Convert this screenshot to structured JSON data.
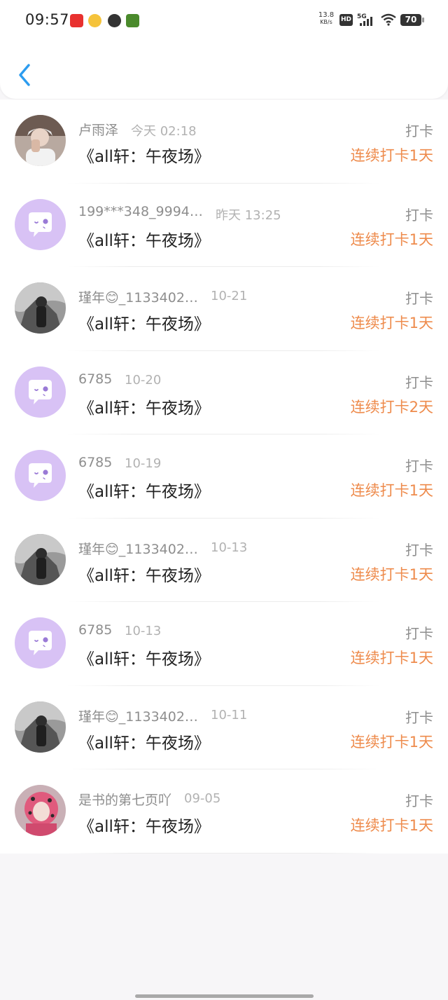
{
  "status_bar": {
    "time": "09:57",
    "net_speed_value": "13.8",
    "net_speed_unit": "KB/s",
    "hd_label": "HD",
    "network_label": "5G",
    "battery_level": "70"
  },
  "colors": {
    "accent_back": "#2c9cef",
    "streak": "#ee8b4c",
    "default_avatar_bg": "#d8c2f5"
  },
  "list": {
    "items": [
      {
        "name": "卢雨泽",
        "date": "今天 02:18",
        "book": "《all轩：午夜场》",
        "action": "打卡",
        "streak": "连续打卡1天",
        "avatar": "photo-user-avatar"
      },
      {
        "name": "199***348_9994…",
        "date": "昨天 13:25",
        "book": "《all轩：午夜场》",
        "action": "打卡",
        "streak": "连续打卡1天",
        "avatar": "default-chat-avatar"
      },
      {
        "name": "瑾年😊_1133402…",
        "date": "10-21",
        "book": "《all轩：午夜场》",
        "action": "打卡",
        "streak": "连续打卡1天",
        "avatar": "dark-photo-avatar"
      },
      {
        "name": "6785",
        "date": "10-20",
        "book": "《all轩：午夜场》",
        "action": "打卡",
        "streak": "连续打卡2天",
        "avatar": "default-chat-avatar"
      },
      {
        "name": "6785",
        "date": "10-19",
        "book": "《all轩：午夜场》",
        "action": "打卡",
        "streak": "连续打卡1天",
        "avatar": "default-chat-avatar"
      },
      {
        "name": "瑾年😊_1133402…",
        "date": "10-13",
        "book": "《all轩：午夜场》",
        "action": "打卡",
        "streak": "连续打卡1天",
        "avatar": "dark-photo-avatar"
      },
      {
        "name": "6785",
        "date": "10-13",
        "book": "《all轩：午夜场》",
        "action": "打卡",
        "streak": "连续打卡1天",
        "avatar": "default-chat-avatar"
      },
      {
        "name": "瑾年😊_1133402…",
        "date": "10-11",
        "book": "《all轩：午夜场》",
        "action": "打卡",
        "streak": "连续打卡1天",
        "avatar": "dark-photo-avatar"
      },
      {
        "name": "是书的第七页吖",
        "date": "09-05",
        "book": "《all轩：午夜场》",
        "action": "打卡",
        "streak": "连续打卡1天",
        "avatar": "pink-photo-avatar"
      }
    ]
  }
}
